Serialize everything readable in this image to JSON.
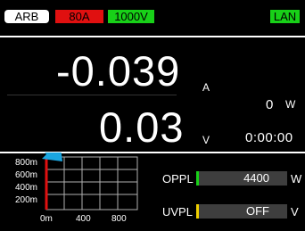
{
  "status": {
    "mode": "ARB",
    "current_range": "80A",
    "voltage_range": "1000V",
    "network": "LAN"
  },
  "readouts": {
    "current_value": "-0.039",
    "current_unit": "A",
    "voltage_value": "0.03",
    "voltage_unit": "V",
    "power_value": "0",
    "power_unit": "W",
    "elapsed_time": "0:00:00"
  },
  "graph": {
    "y_ticks": [
      "800m",
      "600m",
      "400m",
      "200m"
    ],
    "x_ticks": [
      "0m",
      "400",
      "800"
    ],
    "colors": {
      "grid": "#b0b0b0",
      "trace": "#e01010",
      "arrow": "#1aa6e0"
    }
  },
  "limits": {
    "oppl": {
      "label": "OPPL",
      "value": "4400",
      "unit": "W",
      "color": "#18d018"
    },
    "uvpl": {
      "label": "UVPL",
      "value": "OFF",
      "unit": "V",
      "color": "#f0d000"
    }
  }
}
